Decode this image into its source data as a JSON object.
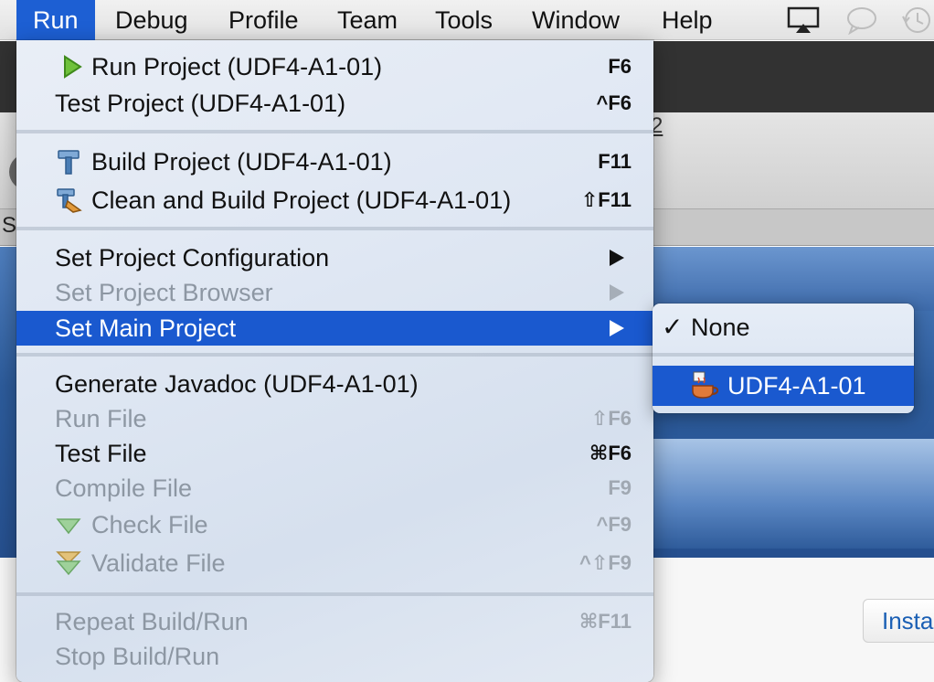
{
  "menubar": {
    "items": [
      {
        "label": "Run",
        "active": true
      },
      {
        "label": "Debug"
      },
      {
        "label": "Profile"
      },
      {
        "label": "Team"
      },
      {
        "label": "Tools"
      },
      {
        "label": "Window"
      },
      {
        "label": "Help"
      }
    ],
    "status_icons": [
      "airplay-icon",
      "speech-bubble-icon",
      "time-machine-icon"
    ]
  },
  "background": {
    "toolbar_fragment": "2",
    "tab_fragment": "St",
    "install_button": "Insta"
  },
  "run_menu": {
    "items": [
      {
        "label": "Run Project (UDF4-A1-01)",
        "shortcut": "F6",
        "icon": "play-icon",
        "enabled": true
      },
      {
        "label": "Test Project (UDF4-A1-01)",
        "shortcut": "^F6",
        "enabled": true
      },
      {
        "label": "Build Project (UDF4-A1-01)",
        "shortcut": "F11",
        "icon": "hammer-icon",
        "enabled": true
      },
      {
        "label": "Clean and Build Project (UDF4-A1-01)",
        "shortcut": "⇧F11",
        "icon": "clean-build-icon",
        "enabled": true
      },
      {
        "label": "Set Project Configuration",
        "submenu": true,
        "enabled": true
      },
      {
        "label": "Set Project Browser",
        "submenu": true,
        "enabled": false
      },
      {
        "label": "Set Main Project",
        "submenu": true,
        "enabled": true,
        "highlighted": true
      },
      {
        "label": "Generate Javadoc (UDF4-A1-01)",
        "enabled": true
      },
      {
        "label": "Run File",
        "shortcut": "⇧F6",
        "enabled": false
      },
      {
        "label": "Test File",
        "shortcut": "⌘F6",
        "enabled": true
      },
      {
        "label": "Compile File",
        "shortcut": "F9",
        "enabled": false
      },
      {
        "label": "Check File",
        "shortcut": "^F9",
        "icon": "check-file-icon",
        "enabled": false
      },
      {
        "label": "Validate File",
        "shortcut": "^⇧F9",
        "icon": "validate-file-icon",
        "enabled": false
      },
      {
        "label": "Repeat Build/Run",
        "shortcut": "⌘F11",
        "enabled": false
      },
      {
        "label": "Stop Build/Run",
        "enabled": false
      }
    ]
  },
  "set_main_project_submenu": {
    "items": [
      {
        "label": "None",
        "checked": true
      },
      {
        "label": "UDF4-A1-01",
        "icon": "java-project-icon",
        "highlighted": true
      }
    ]
  },
  "colors": {
    "accent": "#1a59cf",
    "disabled_text": "#8d97a3"
  }
}
